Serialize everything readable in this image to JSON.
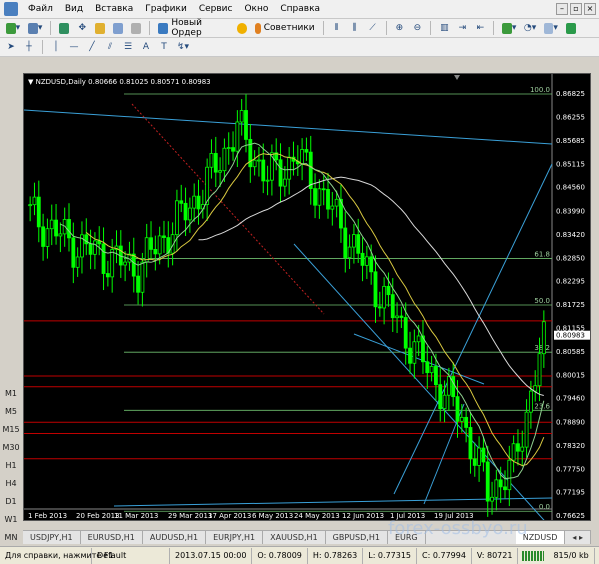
{
  "menu": {
    "items": [
      "Файл",
      "Вид",
      "Вставка",
      "Графики",
      "Сервис",
      "Окно",
      "Справка"
    ]
  },
  "toolbar": {
    "new_order_label": "Новый Ордер",
    "advisors_label": "Советники"
  },
  "chart": {
    "header": "NZDUSD,Daily  0.80666 0.81025 0.80571 0.80983",
    "symbol": "NZDUSD",
    "timeframe": "Daily",
    "ohlc": {
      "open": 0.80666,
      "high": 0.81025,
      "low": 0.80571,
      "close": 0.80983
    },
    "price_axis_labels": [
      "0.86825",
      "0.86255",
      "0.85685",
      "0.85115",
      "0.84560",
      "0.83990",
      "0.83420",
      "0.82850",
      "0.82295",
      "0.81725",
      "0.81155",
      "0.80585",
      "0.80015",
      "0.79460",
      "0.78890",
      "0.78320",
      "0.77750",
      "0.77195",
      "0.76625"
    ],
    "current_price_label": "0.80983",
    "date_axis_labels": [
      "1 Feb 2013",
      "20 Feb 2013",
      "11 Mar 2013",
      "29 Mar 2013",
      "17 Apr 2013",
      "6 May 2013",
      "24 May 2013",
      "12 Jun 2013",
      "1 Jul 2013",
      "19 Jul 2013"
    ],
    "fibo_levels": [
      {
        "label": "100.0",
        "price": 0.86825
      },
      {
        "label": "61.8",
        "price": 0.8285
      },
      {
        "label": "50.0",
        "price": 0.81725
      },
      {
        "label": "38.2",
        "price": 0.80585
      },
      {
        "label": "23.6",
        "price": 0.7918
      },
      {
        "label": "0.0",
        "price": 0.7674
      }
    ],
    "colors": {
      "background": "#000000",
      "bull": "#00ff00",
      "bear": "#00ff00",
      "fibo": "#6fbf6f",
      "trendline": "#3aa0d8",
      "redline": "#c00000",
      "ma_slow": "#d8d8d8",
      "ma_mid": "#d8c840",
      "ma_fast": "#e0e0a0",
      "ma_green": "#8fd08f"
    }
  },
  "timeframes": [
    "M1",
    "M5",
    "M15",
    "M30",
    "H1",
    "H4",
    "D1",
    "W1",
    "MN"
  ],
  "tabs": [
    "USDJPY,H1",
    "EURUSD,H1",
    "AUDUSD,H1",
    "EURJPY,H1",
    "XAUUSD,H1",
    "GBPUSD,H1",
    "EURG",
    "NZDUSD"
  ],
  "status": {
    "help": "Для справки, нажмите F1",
    "profile": "Default",
    "datetime": "2013.07.15 00:00",
    "open": "O: 0.78009",
    "high": "H: 0.78263",
    "low": "L: 0.77315",
    "close": "C: 0.77994",
    "volume": "V: 80721",
    "traffic": "815/0 kb"
  },
  "watermark": "forex-ossbyo.ru"
}
